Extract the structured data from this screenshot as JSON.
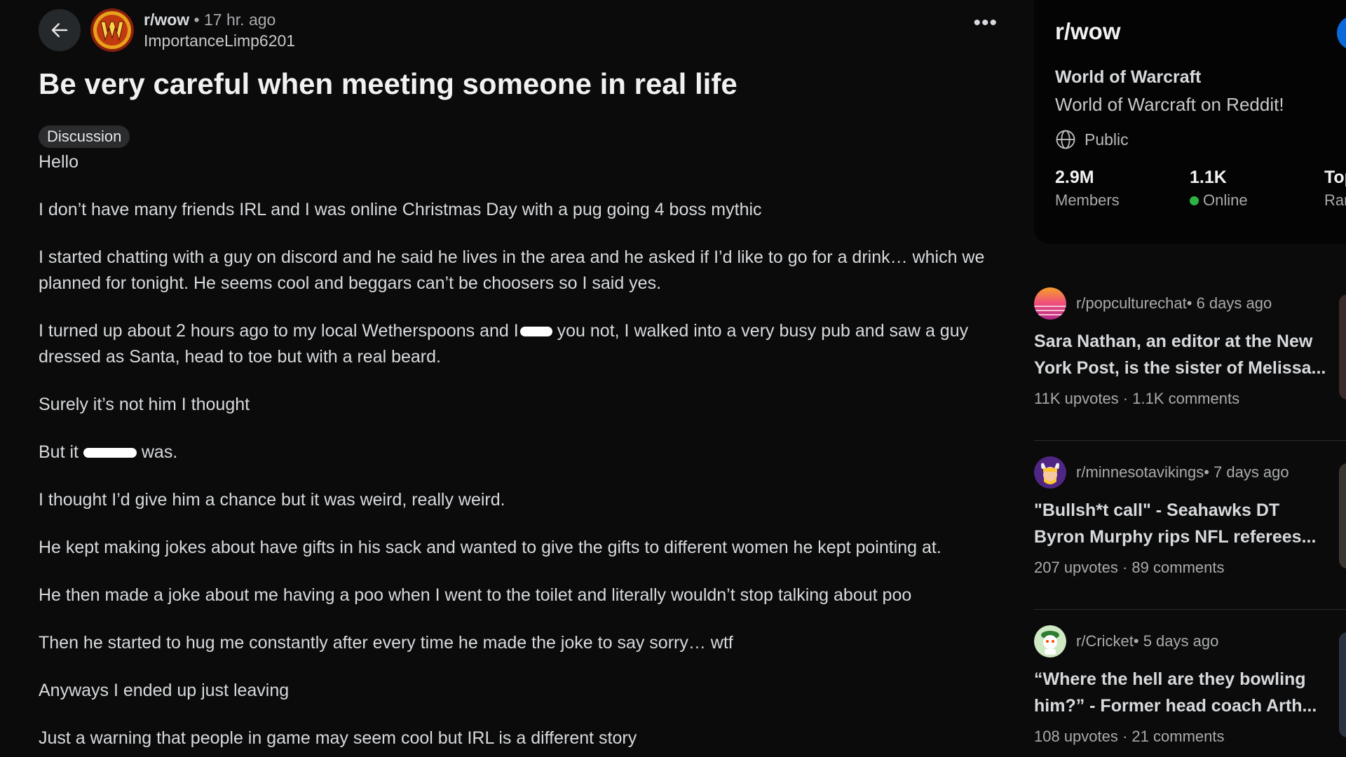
{
  "post": {
    "subreddit": "r/wow",
    "separator": " • ",
    "time": "17 hr. ago",
    "author": "ImportanceLimp6201",
    "more": "•••",
    "title": "Be very careful when meeting someone in real life",
    "flair": "Discussion",
    "body": {
      "p1": "Hello",
      "p2": "I don’t have many friends IRL and I was online Christmas Day with a pug going 4 boss mythic",
      "p3": "I started chatting with a guy on discord and he said he lives in the area and he asked if I’d like to go for a drink… which we planned for tonight. He seems cool and beggars can’t be choosers so I said yes.",
      "p4a": "I turned up about 2 hours ago to my local Wetherspoons and I",
      "p4b": " you not, I walked into a very busy pub and saw a guy dressed as Santa, head to toe but with a real beard.",
      "p5": "Surely it’s not him I thought",
      "p6a": "But it ",
      "p6b": " was.",
      "p7": "I thought I’d give him a chance but it was weird, really weird.",
      "p8": "He kept making jokes about have gifts in his sack and wanted to give the gifts to different women he kept pointing at.",
      "p9": "He then made a joke about me having a poo when I went to the toilet and literally wouldn’t stop talking about poo",
      "p10": "Then he started to hug me constantly after every time he made the joke to say sorry… wtf",
      "p11": "Anyways I ended up just leaving",
      "p12": "Just a warning that people in game may seem cool but IRL is a different story"
    }
  },
  "community": {
    "name": "r/wow",
    "title": "World of Warcraft",
    "description": "World of Warcraft on Reddit!",
    "visibility": "Public",
    "members_value": "2.9M",
    "members_label": "Members",
    "online_value": "1.1K",
    "online_label": "Online",
    "rank_value": "Top",
    "rank_label": "Rank"
  },
  "trending": [
    {
      "subreddit": "r/popculturechat",
      "age": " • 6 days ago",
      "title_line1": "Sara Nathan, an editor at the New",
      "title_line2": "York Post, is the sister of Melissa...",
      "stats": "11K upvotes  ·  1.1K comments"
    },
    {
      "subreddit": "r/minnesotavikings",
      "age": " • 7 days ago",
      "title_line1": "\"Bullsh*t call\" - Seahawks DT",
      "title_line2": "Byron Murphy rips NFL referees...",
      "stats": "207 upvotes  ·  89 comments"
    },
    {
      "subreddit": "r/Cricket",
      "age": " • 5 days ago",
      "title_line1": "“Where the hell are they bowling",
      "title_line2": "him?” - Former head coach Arth...",
      "stats": "108 upvotes  ·  21 comments"
    }
  ],
  "colors": {
    "background": "#0b0b0c",
    "card": "#040404",
    "accent_blue": "#0a6ad9",
    "online_green": "#2fb344"
  }
}
